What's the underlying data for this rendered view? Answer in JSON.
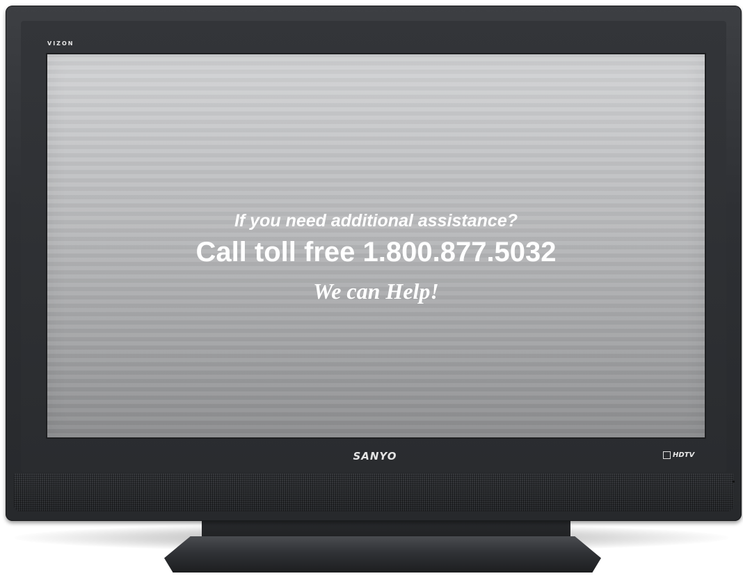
{
  "tv": {
    "model_logo": "VIZON",
    "brand_logo": "SANYO",
    "badge": "HDTV"
  },
  "screen": {
    "question": "If you need additional assistance?",
    "phone_line": "Call toll free 1.800.877.5032",
    "help_line": "We can Help!"
  },
  "colors": {
    "bezel": "#2e3034",
    "screen_top": "#d2d3d5",
    "screen_bottom": "#8d8e90",
    "text": "#ffffff"
  }
}
